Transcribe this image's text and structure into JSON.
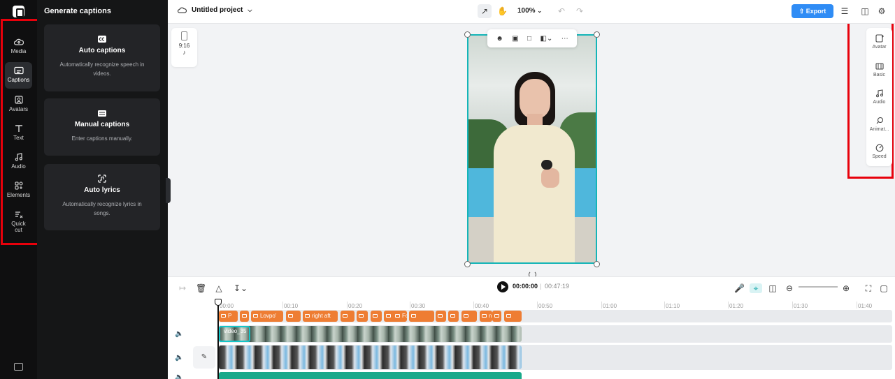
{
  "rail": {
    "items": [
      {
        "label": "Media",
        "icon": "cloud-upload-icon"
      },
      {
        "label": "Captions",
        "icon": "captions-icon",
        "active": true
      },
      {
        "label": "Avatars",
        "icon": "avatar-icon"
      },
      {
        "label": "Text",
        "icon": "text-icon"
      },
      {
        "label": "Audio",
        "icon": "music-note-icon"
      },
      {
        "label": "Elements",
        "icon": "elements-icon"
      },
      {
        "label": "Quick cut",
        "icon": "quick-cut-icon"
      }
    ]
  },
  "panel": {
    "title": "Generate captions",
    "cards": [
      {
        "title": "Auto captions",
        "desc": "Automatically recognize speech in videos.",
        "icon": "cc-icon"
      },
      {
        "title": "Manual captions",
        "desc": "Enter captions manually.",
        "icon": "keyboard-icon"
      },
      {
        "title": "Auto lyrics",
        "desc": "Automatically recognize lyrics in songs.",
        "icon": "music-sparkle-icon"
      }
    ]
  },
  "topbar": {
    "project_name": "Untitled project",
    "zoom": "100%",
    "export_label": "Export"
  },
  "canvas": {
    "ratio_label": "9:16",
    "platform_icon": "tiktok-icon"
  },
  "right_bar": {
    "items": [
      {
        "label": "Avatar",
        "icon": "avatar-add-icon"
      },
      {
        "label": "Basic",
        "icon": "film-icon"
      },
      {
        "label": "Audio",
        "icon": "music-note-icon"
      },
      {
        "label": "Animat...",
        "icon": "animation-icon"
      },
      {
        "label": "Speed",
        "icon": "speed-icon"
      }
    ]
  },
  "timeline": {
    "current_time": "00:00:00",
    "separator": "|",
    "total_time": "00:47:19",
    "ruler": [
      "00:00",
      "00:10",
      "00:20",
      "00:30",
      "00:40",
      "00:50",
      "01:00",
      "01:10",
      "01:20",
      "01:30",
      "01:40"
    ],
    "captions": [
      "P",
      "",
      "Lovpo'",
      "",
      "right aft",
      "",
      "",
      "",
      "givi",
      "For",
      "",
      "",
      "",
      "",
      "n"
    ],
    "video_label": "video_35"
  },
  "colors": {
    "accent": "#2f8cf5",
    "selection": "#14b5b8",
    "caption_clip": "#ee7d33",
    "audio_track": "#19a98a",
    "highlight_box": "#e8000b"
  }
}
